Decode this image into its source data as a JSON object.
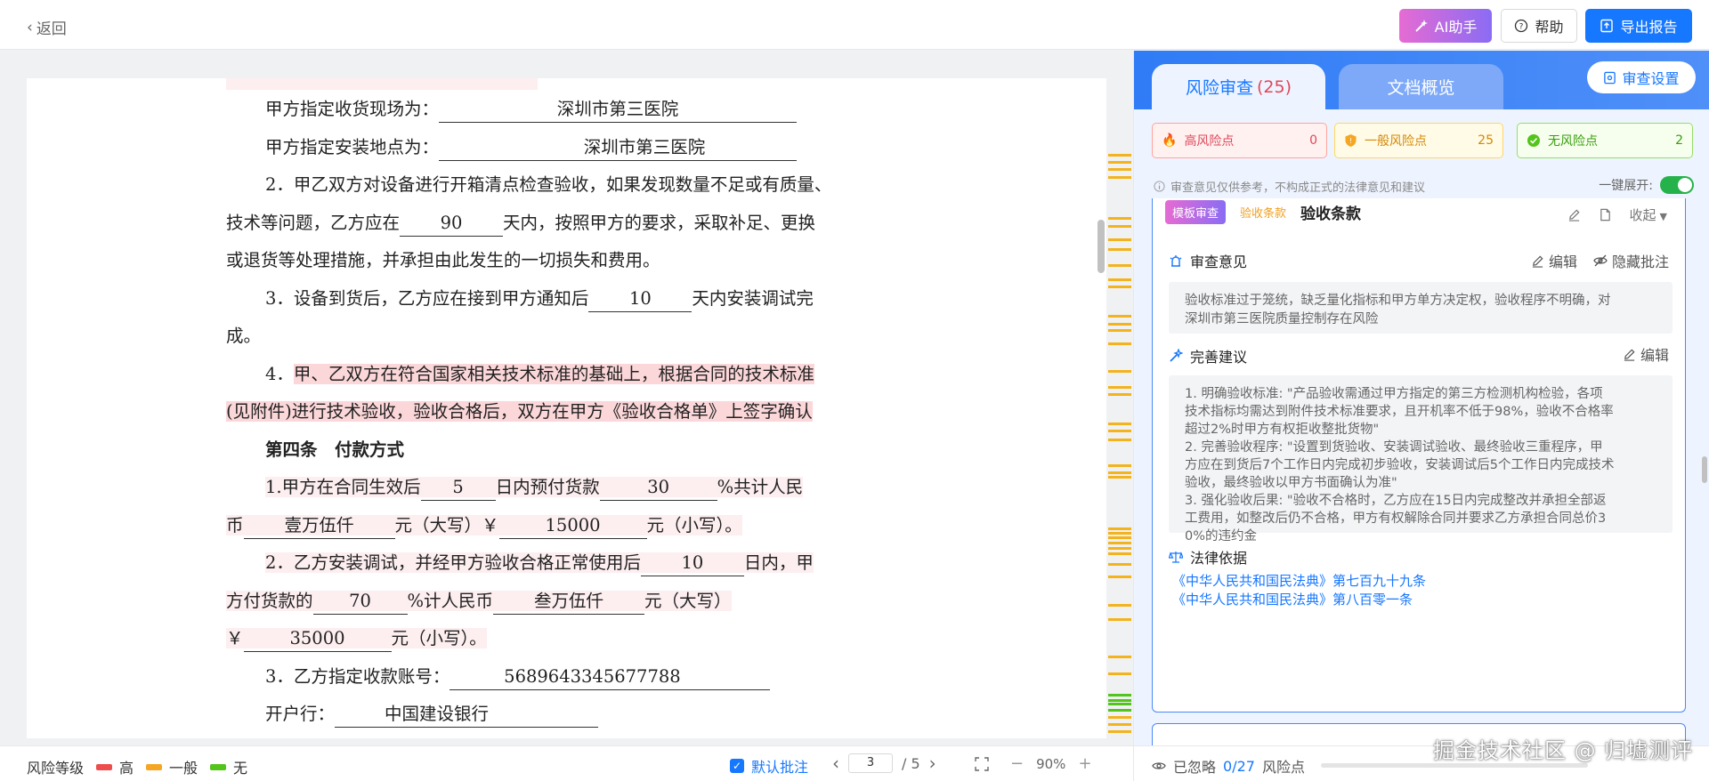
{
  "header": {
    "back_label": "返回",
    "ai_label": "AI助手",
    "help_label": "帮助",
    "export_label": "导出报告"
  },
  "document": {
    "line_receive": {
      "label": "甲方指定收货现场为：",
      "value": "深圳市第三医院"
    },
    "line_install": {
      "label": "甲方指定安装地点为：",
      "value": "深圳市第三医院"
    },
    "clause2": {
      "a": "2．甲乙双方对设备进行开箱清点检查验收，如果发现数量不足或有质量、",
      "b": "技术等问题，乙方应在",
      "days": "90",
      "c": "天内，按照甲方的要求，采取补足、更换",
      "d": "或退货等处理措施，并承担由此发生的一切损失和费用。"
    },
    "clause3": {
      "a": "3．设备到货后，乙方应在接到甲方通知后",
      "days": "10",
      "b": "天内安装调试完",
      "c": "成。"
    },
    "clause4": {
      "a": "4．",
      "b": "甲、乙双方在符合国家相关技术标准的基础上，根据合同的技术标准",
      "c": "(见附件)进行技术验收，验收合格后，双方在甲方《验收合格单》上签字确认"
    },
    "article4_title": "第四条　付款方式",
    "pay1": {
      "a": "1.甲方在合同生效后",
      "days": "5",
      "b": "日内预付货款",
      "pct": "30",
      "c": "%共计人民",
      "d": "币",
      "upper": "壹万伍仟",
      "e": "元（大写）￥",
      "lower": "15000",
      "f": "元（小写）。"
    },
    "pay2": {
      "a": "2．乙方安装调试，并经甲方验收合格正常使用后",
      "days": "10",
      "b": "日内，甲",
      "c": "方付货款的",
      "pct": "70",
      "d": "%计人民币",
      "upper": "叁万伍仟",
      "e": "元（大写）",
      "f": "￥",
      "lower": "35000",
      "g": "元（小写）。"
    },
    "account": {
      "label": "3．乙方指定收款账号：",
      "value": "5689643345677788"
    },
    "bank": {
      "label": "开户行：",
      "value": "中国建设银行"
    }
  },
  "bottom_bar": {
    "risk_level_label": "风险等级",
    "levels": [
      {
        "label": "高",
        "color": "#ee4d4d"
      },
      {
        "label": "一般",
        "color": "#f5a623"
      },
      {
        "label": "无",
        "color": "#52c41a"
      }
    ],
    "default_annotation_label": "默认批注",
    "page_current": "3",
    "page_total": "/ 5",
    "zoom": "90%"
  },
  "panel": {
    "tab_risk_label": "风险审查",
    "tab_risk_count": "(25)",
    "tab_overview_label": "文档概览",
    "settings_label": "审查设置",
    "stats": {
      "high": {
        "label": "高风险点",
        "count": "0"
      },
      "medium": {
        "label": "一般风险点",
        "count": "25"
      },
      "none": {
        "label": "无风险点",
        "count": "2"
      }
    },
    "notice": "审查意见仅供参考，不构成正式的法律意见和建议",
    "expand_label": "一键展开:",
    "card": {
      "tag_template": "模板审查",
      "tag_type": "验收条款",
      "title": "验收条款",
      "collapse_label": "收起",
      "opinion_title": "审查意见",
      "edit_label": "编辑",
      "hide_label": "隐藏批注",
      "opinion_text": "验收标准过于笼统，缺乏量化指标和甲方单方决定权，验收程序不明确，对\n深圳市第三医院质量控制存在风险",
      "suggest_title": "完善建议",
      "suggest_edit_label": "编辑",
      "suggest_text": "1. 明确验收标准: \"产品验收需通过甲方指定的第三方检测机构检验，各项\n技术指标均需达到附件技术标准要求，且开机率不低于98%，验收不合格率\n超过2%时甲方有权拒收整批货物\"\n2. 完善验收程序: \"设置到货验收、安装调试验收、最终验收三重程序，甲\n方应在到货后7个工作日内完成初步验收，安装调试后5个工作日内完成技术\n验收，最终验收以甲方书面确认为准\"\n3. 强化验收后果: \"验收不合格时，乙方应在15日内完成整改并承担全部返\n工费用，如整改后仍不合格，甲方有权解除合同并要求乙方承担合同总价3\n0%的违约金",
      "law_title": "法律依据",
      "laws": [
        "《中华人民共和国民法典》第七百九十九条",
        "《中华人民共和国民法典》第八百零一条"
      ]
    },
    "footer": {
      "ignored_prefix": "已忽略",
      "ignored_count": "0/27",
      "ignored_suffix": "风险点"
    }
  },
  "watermark": "掘金技术社区 @ 归墟测评"
}
